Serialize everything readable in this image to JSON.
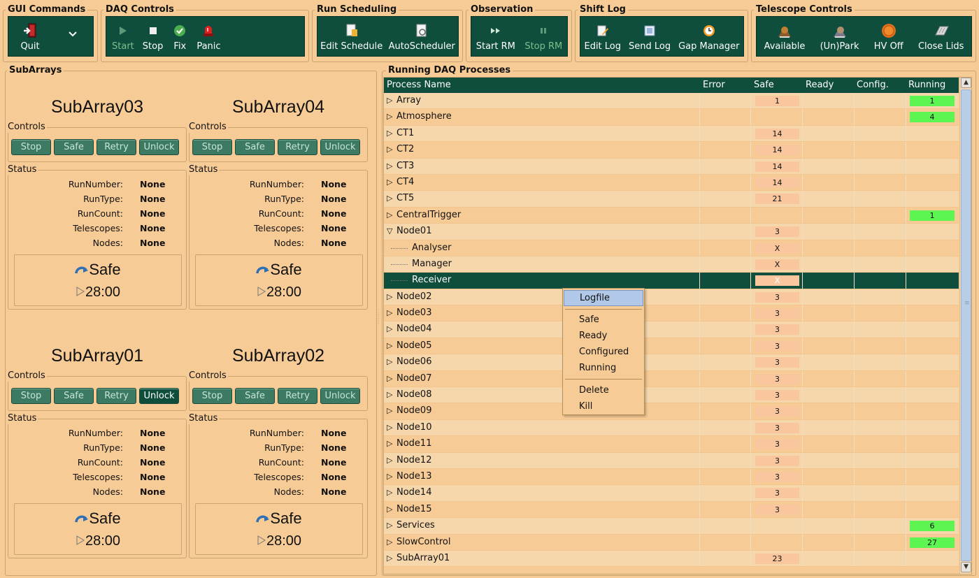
{
  "toolbar": {
    "groups": [
      {
        "title": "GUI Commands",
        "buttons": [
          {
            "label": "Quit",
            "icon": "exit-door-icon",
            "enabled": true
          },
          {
            "label": "",
            "icon": "chevron-down-icon",
            "enabled": true
          }
        ]
      },
      {
        "title": "DAQ Controls",
        "buttons": [
          {
            "label": "Start",
            "icon": "play-icon",
            "enabled": false
          },
          {
            "label": "Stop",
            "icon": "stop-square-icon",
            "enabled": true
          },
          {
            "label": "Fix",
            "icon": "check-circle-icon",
            "enabled": true
          },
          {
            "label": "Panic",
            "icon": "alarm-light-icon",
            "enabled": true
          }
        ]
      },
      {
        "title": "Run Scheduling",
        "buttons": [
          {
            "label": "Edit Schedule",
            "icon": "edit-document-icon",
            "enabled": true
          },
          {
            "label": "AutoScheduler",
            "icon": "scheduler-document-icon",
            "enabled": true
          }
        ]
      },
      {
        "title": "Observation",
        "buttons": [
          {
            "label": "Start RM",
            "icon": "fast-forward-icon",
            "enabled": true
          },
          {
            "label": "Stop RM",
            "icon": "pause-icon",
            "enabled": false
          }
        ]
      },
      {
        "title": "Shift Log",
        "buttons": [
          {
            "label": "Edit Log",
            "icon": "edit-pencil-icon",
            "enabled": true
          },
          {
            "label": "Send Log",
            "icon": "send-log-icon",
            "enabled": true
          },
          {
            "label": "Gap Manager",
            "icon": "clock-icon",
            "enabled": true
          }
        ]
      },
      {
        "title": "Telescope Controls",
        "buttons": [
          {
            "label": "Available",
            "icon": "telescope-icon",
            "enabled": true
          },
          {
            "label": "(Un)Park",
            "icon": "telescope-park-icon",
            "enabled": true
          },
          {
            "label": "HV Off",
            "icon": "hv-off-icon",
            "enabled": true
          },
          {
            "label": "Close Lids",
            "icon": "lids-icon",
            "enabled": true
          }
        ]
      }
    ]
  },
  "subarrays_panel": {
    "title": "SubArrays",
    "controls_label": "Controls",
    "status_label": "Status",
    "control_buttons": [
      "Stop",
      "Safe",
      "Retry",
      "Unlock"
    ],
    "status_keys": [
      "RunNumber:",
      "RunType:",
      "RunCount:",
      "Telescopes:",
      "Nodes:"
    ],
    "subarrays": [
      {
        "name": "SubArray03",
        "status_values": [
          "None",
          "None",
          "None",
          "None",
          "None"
        ],
        "state": "Safe",
        "time": "28:00",
        "unlock_active": false
      },
      {
        "name": "SubArray04",
        "status_values": [
          "None",
          "None",
          "None",
          "None",
          "None"
        ],
        "state": "Safe",
        "time": "28:00",
        "unlock_active": false
      },
      {
        "name": "SubArray01",
        "status_values": [
          "None",
          "None",
          "None",
          "None",
          "None"
        ],
        "state": "Safe",
        "time": "28:00",
        "unlock_active": true
      },
      {
        "name": "SubArray02",
        "status_values": [
          "None",
          "None",
          "None",
          "None",
          "None"
        ],
        "state": "Safe",
        "time": "28:00",
        "unlock_active": false
      }
    ]
  },
  "daq_panel": {
    "title": "Running DAQ Processes",
    "columns": [
      "Process Name",
      "Error",
      "Safe",
      "Ready",
      "Config.",
      "Running"
    ],
    "rows": [
      {
        "name": "Array",
        "expander": "collapsed",
        "safe": "1",
        "running": "1"
      },
      {
        "name": "Atmosphere",
        "expander": "collapsed",
        "safe": "",
        "running": "4"
      },
      {
        "name": "CT1",
        "expander": "collapsed",
        "safe": "14",
        "running": ""
      },
      {
        "name": "CT2",
        "expander": "collapsed",
        "safe": "14",
        "running": ""
      },
      {
        "name": "CT3",
        "expander": "collapsed",
        "safe": "14",
        "running": ""
      },
      {
        "name": "CT4",
        "expander": "collapsed",
        "safe": "14",
        "running": ""
      },
      {
        "name": "CT5",
        "expander": "collapsed",
        "safe": "21",
        "running": ""
      },
      {
        "name": "CentralTrigger",
        "expander": "collapsed",
        "safe": "",
        "running": "1"
      },
      {
        "name": "Node01",
        "expander": "expanded",
        "safe": "3",
        "running": ""
      },
      {
        "name": "Analyser",
        "expander": "child",
        "safe": "X",
        "running": ""
      },
      {
        "name": "Manager",
        "expander": "child",
        "safe": "X",
        "running": ""
      },
      {
        "name": "Receiver",
        "expander": "child",
        "safe": "X",
        "running": "",
        "selected": true
      },
      {
        "name": "Node02",
        "expander": "collapsed",
        "safe": "3",
        "running": ""
      },
      {
        "name": "Node03",
        "expander": "collapsed",
        "safe": "3",
        "running": ""
      },
      {
        "name": "Node04",
        "expander": "collapsed",
        "safe": "3",
        "running": ""
      },
      {
        "name": "Node05",
        "expander": "collapsed",
        "safe": "3",
        "running": ""
      },
      {
        "name": "Node06",
        "expander": "collapsed",
        "safe": "3",
        "running": ""
      },
      {
        "name": "Node07",
        "expander": "collapsed",
        "safe": "3",
        "running": ""
      },
      {
        "name": "Node08",
        "expander": "collapsed",
        "safe": "3",
        "running": ""
      },
      {
        "name": "Node09",
        "expander": "collapsed",
        "safe": "3",
        "running": ""
      },
      {
        "name": "Node10",
        "expander": "collapsed",
        "safe": "3",
        "running": ""
      },
      {
        "name": "Node11",
        "expander": "collapsed",
        "safe": "3",
        "running": ""
      },
      {
        "name": "Node12",
        "expander": "collapsed",
        "safe": "3",
        "running": ""
      },
      {
        "name": "Node13",
        "expander": "collapsed",
        "safe": "3",
        "running": ""
      },
      {
        "name": "Node14",
        "expander": "collapsed",
        "safe": "3",
        "running": ""
      },
      {
        "name": "Node15",
        "expander": "collapsed",
        "safe": "3",
        "running": ""
      },
      {
        "name": "Services",
        "expander": "collapsed",
        "safe": "",
        "running": "6"
      },
      {
        "name": "SlowControl",
        "expander": "collapsed",
        "safe": "",
        "running": "27"
      },
      {
        "name": "SubArray01",
        "expander": "collapsed",
        "safe": "23",
        "running": ""
      }
    ]
  },
  "context_menu": {
    "items": [
      "Logfile",
      "Safe",
      "Ready",
      "Configured",
      "Running",
      "Delete",
      "Kill"
    ],
    "highlighted": "Logfile"
  },
  "colors": {
    "background": "#f7cb95",
    "dark_green": "#0f4d3d",
    "running_green": "#5cf552",
    "safe_cell": "#f9c69e"
  }
}
